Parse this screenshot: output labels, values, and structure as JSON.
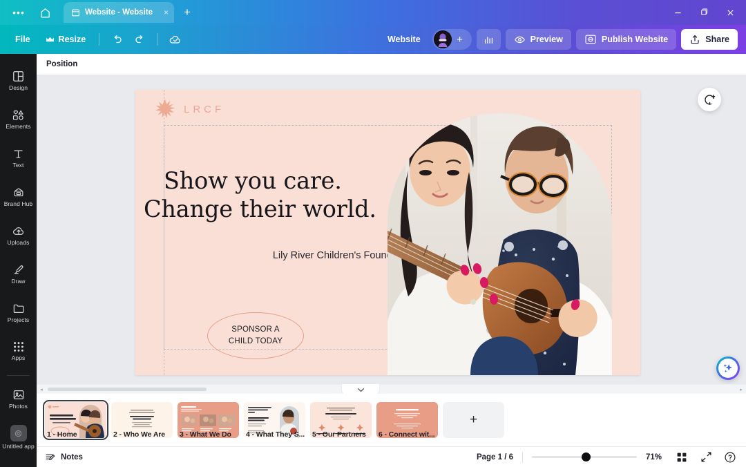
{
  "window": {
    "tab_title": "Website - Website",
    "new_tab_label": "+",
    "close_tab_label": "×",
    "minimize_label": "–",
    "maximize_label": "❐",
    "close_label": "×",
    "dots_label": "•••"
  },
  "toolbar": {
    "file_label": "File",
    "resize_label": "Resize",
    "undo_name": "undo-icon",
    "redo_name": "redo-icon",
    "cloud_name": "cloud-saved-icon",
    "doc_type_label": "Website",
    "add_collaborator_label": "+",
    "insights_name": "insights-icon",
    "preview_label": "Preview",
    "publish_label": "Publish Website",
    "share_label": "Share"
  },
  "sidebar": {
    "items": [
      {
        "label": "Design",
        "icon": "design-icon"
      },
      {
        "label": "Elements",
        "icon": "elements-icon"
      },
      {
        "label": "Text",
        "icon": "text-icon"
      },
      {
        "label": "Brand Hub",
        "icon": "brand-hub-icon"
      },
      {
        "label": "Uploads",
        "icon": "uploads-icon"
      },
      {
        "label": "Draw",
        "icon": "draw-icon"
      },
      {
        "label": "Projects",
        "icon": "projects-icon"
      },
      {
        "label": "Apps",
        "icon": "apps-icon"
      }
    ],
    "pinned": [
      {
        "label": "Photos",
        "icon": "photos-icon"
      },
      {
        "label": "Untitled app",
        "icon": "untitled-app-icon"
      }
    ]
  },
  "subbar": {
    "position_label": "Position"
  },
  "canvas": {
    "brand_name": "LRCF",
    "headline_line1": "Show you care.",
    "headline_line2": "Change their world.",
    "subheadline": "Lily River Children's Foundation",
    "cta_line1": "SPONSOR A",
    "cta_line2": "CHILD TODAY",
    "photo_alt": "woman-and-child-playing-ukulele",
    "page_bg": "#fadfd7",
    "accent": "#e29e84",
    "comment_icon": "add-comment-icon",
    "magic_icon": "magic-studio-sparkle-icon"
  },
  "pages": {
    "collapse_label": "⌄",
    "add_page_label": "+",
    "scroll_left_label": "◂",
    "scroll_right_label": "▸",
    "items": [
      {
        "label": "1 - Home",
        "selected": true,
        "theme": "light"
      },
      {
        "label": "2 - Who We Are",
        "selected": false,
        "theme": "cream"
      },
      {
        "label": "3 - What We Do",
        "selected": false,
        "theme": "salmon"
      },
      {
        "label": "4 - What They S...",
        "selected": false,
        "theme": "light"
      },
      {
        "label": "5 - Our Partners",
        "selected": false,
        "theme": "light"
      },
      {
        "label": "6 - Connect wit...",
        "selected": false,
        "theme": "salmon"
      }
    ]
  },
  "status": {
    "notes_label": "Notes",
    "page_indicator": "Page 1 / 6",
    "zoom_level": "71%",
    "grid_view_icon": "grid-view-icon",
    "fullscreen_icon": "fullscreen-icon",
    "help_icon": "help-icon"
  }
}
